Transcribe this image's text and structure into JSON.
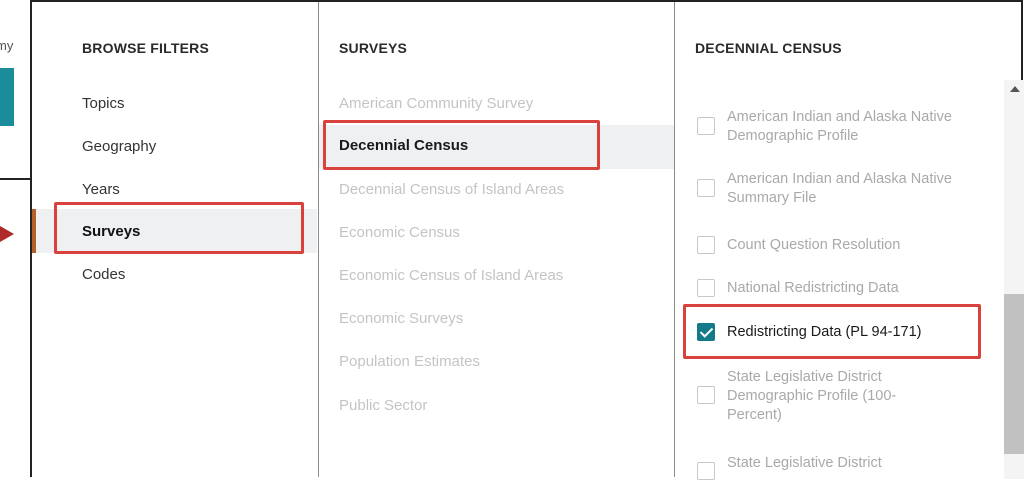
{
  "background": {
    "partial_text": "my"
  },
  "filters": {
    "heading": "BROWSE FILTERS",
    "items": [
      {
        "label": "Topics"
      },
      {
        "label": "Geography"
      },
      {
        "label": "Years"
      },
      {
        "label": "Surveys"
      },
      {
        "label": "Codes"
      }
    ],
    "selected": "Surveys"
  },
  "surveys": {
    "heading": "SURVEYS",
    "items": [
      {
        "label": "American Community Survey"
      },
      {
        "label": "Decennial Census"
      },
      {
        "label": "Decennial Census of Island Areas"
      },
      {
        "label": "Economic Census"
      },
      {
        "label": "Economic Census of Island Areas"
      },
      {
        "label": "Economic Surveys"
      },
      {
        "label": "Population Estimates"
      },
      {
        "label": "Public Sector"
      }
    ],
    "selected": "Decennial Census"
  },
  "decennial": {
    "heading": "DECENNIAL CENSUS",
    "items": [
      {
        "label": "American Indian and Alaska Native Demographic Profile",
        "checked": false
      },
      {
        "label": "American Indian and Alaska Native Summary File",
        "checked": false
      },
      {
        "label": "Count Question Resolution",
        "checked": false
      },
      {
        "label": "National Redistricting Data",
        "checked": false
      },
      {
        "label": "Redistricting Data (PL 94-171)",
        "checked": true
      },
      {
        "label": "State Legislative District Demographic Profile (100-Percent)",
        "checked": false
      },
      {
        "label": "State Legislative District",
        "checked": false
      }
    ]
  },
  "colors": {
    "accent_teal": "#137a8a",
    "highlight_red": "#d9423c",
    "active_bar": "#b3602a"
  }
}
